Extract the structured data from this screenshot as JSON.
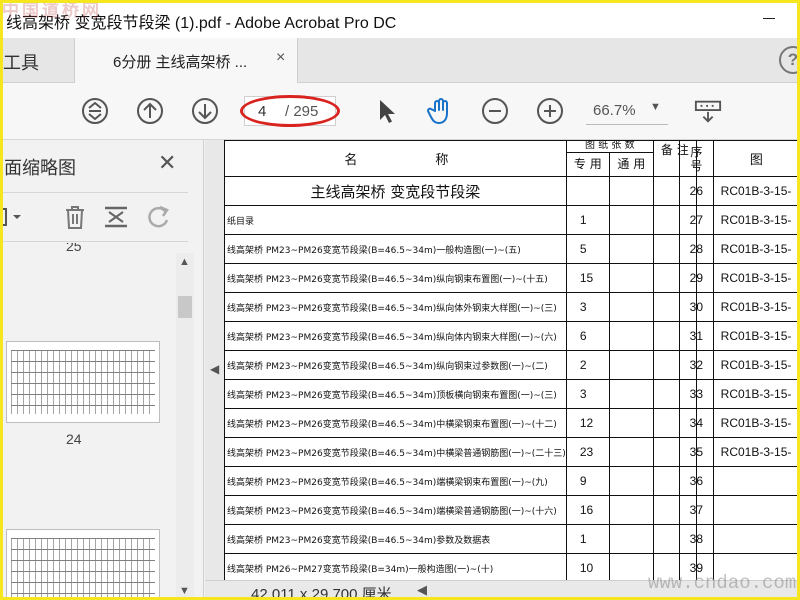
{
  "window": {
    "title": "线高架桥 变宽段节段梁 (1).pdf - Adobe Acrobat Pro DC"
  },
  "tabs": {
    "tools": "工具",
    "document": "6分册 主线高架桥 ...",
    "close": "×",
    "help": "?"
  },
  "toolbar": {
    "page_current": "4",
    "page_total": "/ 295",
    "zoom": "66.7%",
    "icons": [
      "fit-page-icon",
      "previous-page-icon",
      "next-page-icon",
      "select-arrow-icon",
      "hand-tool-icon",
      "zoom-out-icon",
      "zoom-in-icon",
      "page-display-icon"
    ]
  },
  "panel": {
    "title": "面缩略图",
    "close": "✕",
    "tool_icons": [
      "page-options-icon",
      "delete-icon",
      "crop-icon",
      "rotate-icon"
    ],
    "thumbnails": [
      {
        "label": "25"
      },
      {
        "label": "24"
      },
      {
        "label": ""
      }
    ]
  },
  "table": {
    "header": {
      "name": "名　　　　　　称",
      "count_group": "图 纸 张 数",
      "dedicated": "专 用",
      "general": "通 用",
      "note": "备 注"
    },
    "section_title": "主线高架桥 变宽段节段梁",
    "rows": [
      {
        "desc": "纸目录",
        "count": "1"
      },
      {
        "desc": "线高架桥 PM23~PM26变宽节段梁(B=46.5~34m)一般构造图(一)~(五)",
        "count": "5"
      },
      {
        "desc": "线高架桥 PM23~PM26变宽节段梁(B=46.5~34m)纵向钢束布置图(一)~(十五)",
        "count": "15"
      },
      {
        "desc": "线高架桥 PM23~PM26变宽节段梁(B=46.5~34m)纵向体外钢束大样图(一)~(三)",
        "count": "3"
      },
      {
        "desc": "线高架桥 PM23~PM26变宽节段梁(B=46.5~34m)纵向体内钢束大样图(一)~(六)",
        "count": "6"
      },
      {
        "desc": "线高架桥 PM23~PM26变宽节段梁(B=46.5~34m)纵向钢束过参数图(一)~(二)",
        "count": "2"
      },
      {
        "desc": "线高架桥 PM23~PM26变宽节段梁(B=46.5~34m)顶板横向钢束布置图(一)~(三)",
        "count": "3"
      },
      {
        "desc": "线高架桥 PM23~PM26变宽节段梁(B=46.5~34m)中横梁钢束布置图(一)~(十二)",
        "count": "12"
      },
      {
        "desc": "线高架桥 PM23~PM26变宽节段梁(B=46.5~34m)中横梁普通钢筋图(一)~(二十三)",
        "count": "23"
      },
      {
        "desc": "线高架桥 PM23~PM26变宽节段梁(B=46.5~34m)端横梁钢束布置图(一)~(九)",
        "count": "9"
      },
      {
        "desc": "线高架桥 PM23~PM26变宽节段梁(B=46.5~34m)端横梁普通钢筋图(一)~(十六)",
        "count": "16"
      },
      {
        "desc": "线高架桥 PM23~PM26变宽节段梁(B=46.5~34m)参数及数据表",
        "count": "1"
      },
      {
        "desc": "线高架桥 PM26~PM27变宽节段梁(B=34m)一般构造图(一)~(十)",
        "count": "10"
      }
    ],
    "right": {
      "header_seq": "序\n号",
      "header_code": "图",
      "rows": [
        {
          "seq": "26",
          "code": "RC01B-3-15-"
        },
        {
          "seq": "27",
          "code": "RC01B-3-15-"
        },
        {
          "seq": "28",
          "code": "RC01B-3-15-"
        },
        {
          "seq": "29",
          "code": "RC01B-3-15-"
        },
        {
          "seq": "30",
          "code": "RC01B-3-15-"
        },
        {
          "seq": "31",
          "code": "RC01B-3-15-"
        },
        {
          "seq": "32",
          "code": "RC01B-3-15-"
        },
        {
          "seq": "33",
          "code": "RC01B-3-15-"
        },
        {
          "seq": "34",
          "code": "RC01B-3-15-"
        },
        {
          "seq": "35",
          "code": "RC01B-3-15-"
        },
        {
          "seq": "36",
          "code": ""
        },
        {
          "seq": "37",
          "code": ""
        },
        {
          "seq": "38",
          "code": ""
        },
        {
          "seq": "39",
          "code": ""
        }
      ]
    }
  },
  "status": {
    "dimensions": "42.011 x 29.700 厘米"
  },
  "watermarks": {
    "top": "中国道桥网",
    "bottom": "www.cndao.com"
  },
  "colors": {
    "highlight_oval": "#d8231f",
    "frame": "#f5e61e",
    "hand_tool": "#1a73c9"
  }
}
